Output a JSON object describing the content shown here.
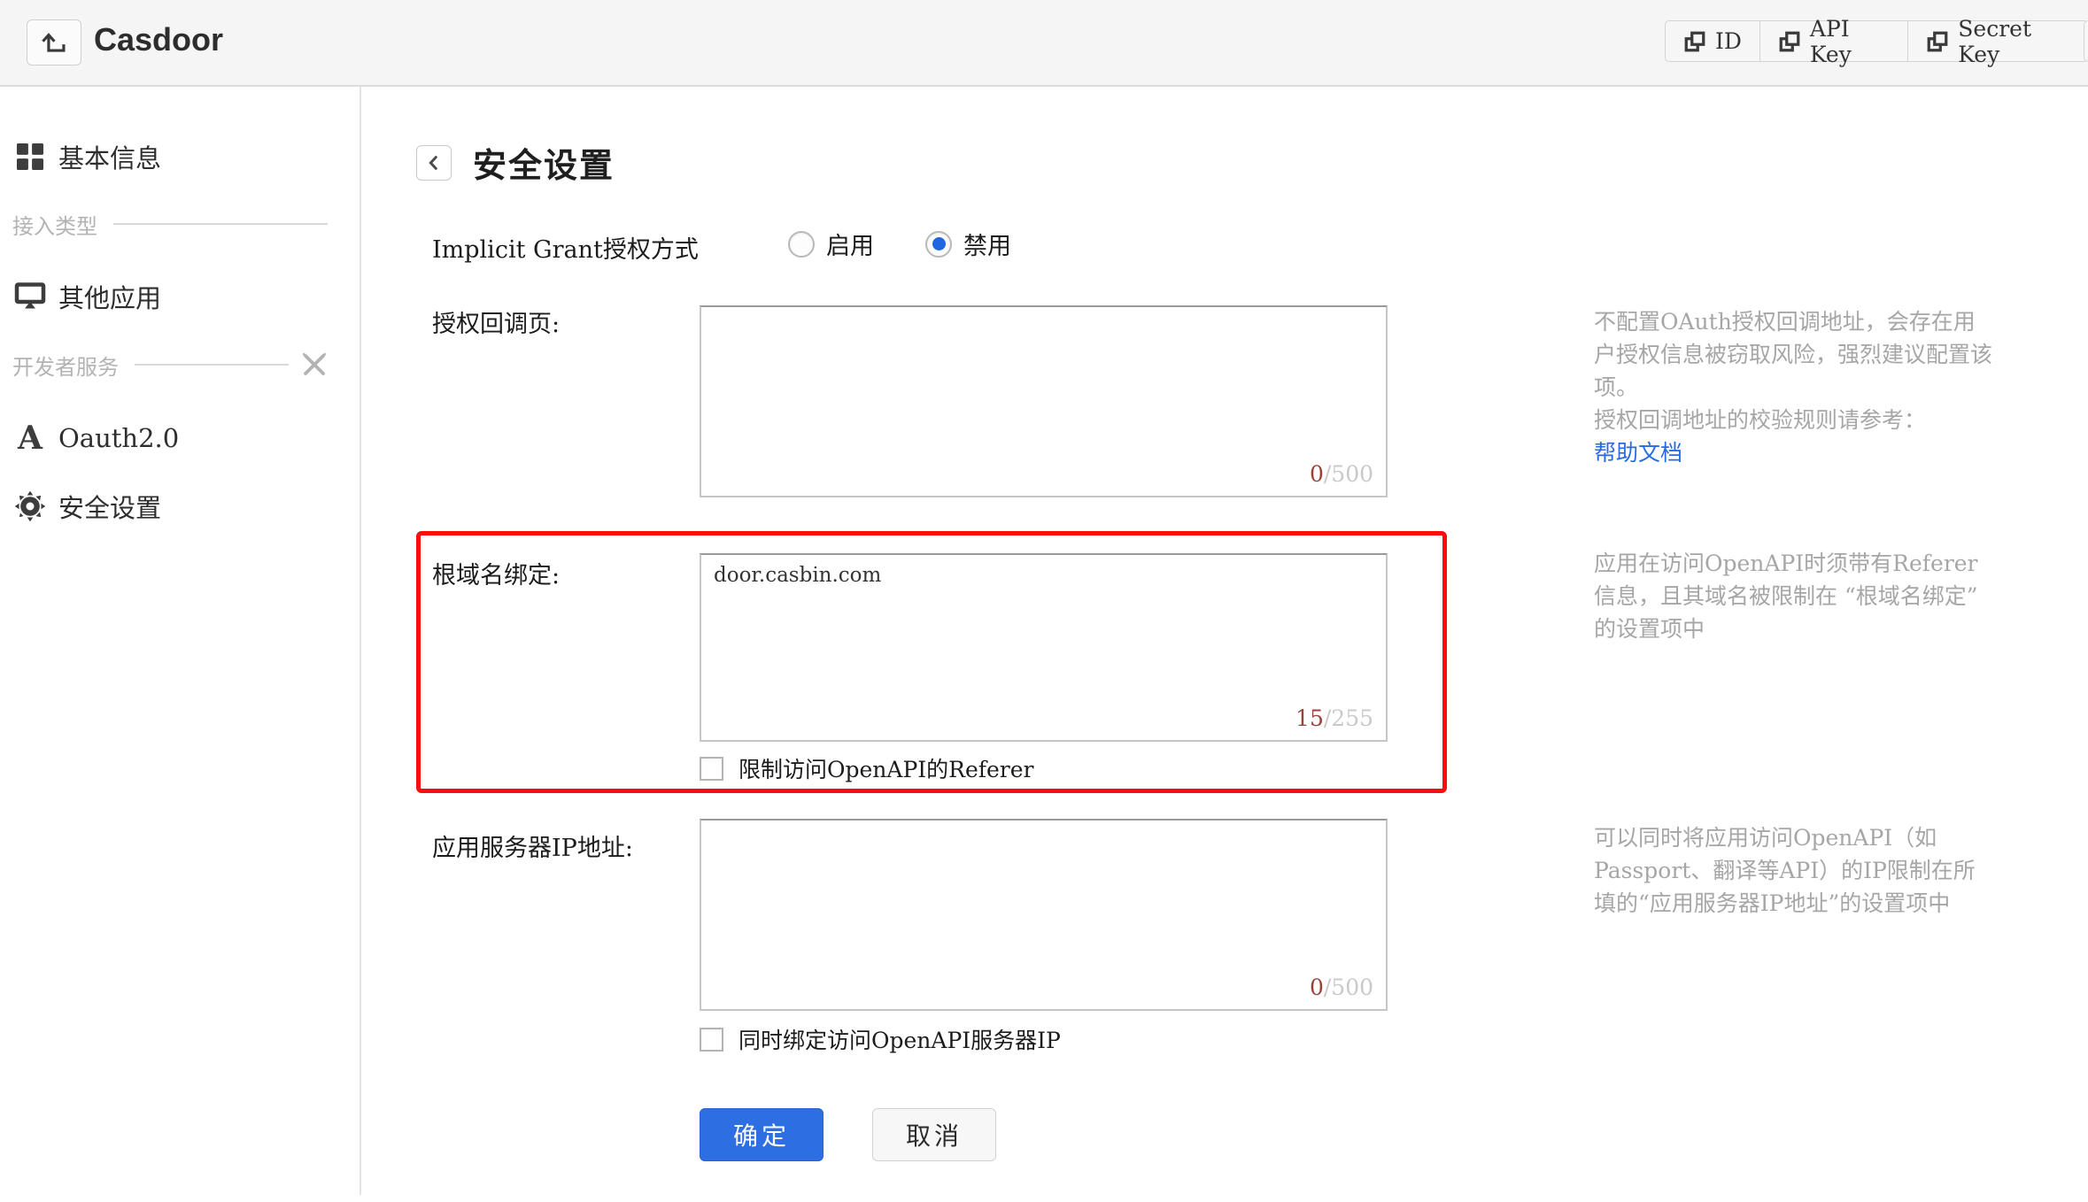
{
  "header": {
    "app_title": "Casdoor",
    "copy_buttons": [
      {
        "label": "ID"
      },
      {
        "label": "API Key"
      },
      {
        "label": "Secret Key"
      }
    ]
  },
  "sidebar": {
    "items": [
      {
        "label": "基本信息",
        "icon": "grid-icon"
      },
      {
        "label": "其他应用",
        "icon": "monitor-icon"
      },
      {
        "label": "Oauth2.0",
        "icon": "oauth-a-icon"
      },
      {
        "label": "安全设置",
        "icon": "gear-icon"
      }
    ],
    "dividers": [
      {
        "label": "接入类型"
      },
      {
        "label": "开发者服务",
        "icon": "tools-icon"
      }
    ]
  },
  "main": {
    "page_title": "安全设置",
    "implicit": {
      "label": "Implicit Grant授权方式",
      "options": [
        {
          "label": "启用",
          "selected": false
        },
        {
          "label": "禁用",
          "selected": true
        }
      ]
    },
    "fields": {
      "callback": {
        "label": "授权回调页:",
        "value": "",
        "counter_current": "0",
        "counter_max": "/500",
        "help1": "不配置OAuth授权回调地址，会存在用户授权信息被窃取风险，强烈建议配置该项。",
        "help2": "授权回调地址的校验规则请参考：",
        "help_link": "帮助文档"
      },
      "root_domain": {
        "label": "根域名绑定:",
        "value": "door.casbin.com",
        "counter_current": "15",
        "counter_max": "/255",
        "checkbox_label": "限制访问OpenAPI的Referer",
        "checkbox_checked": false,
        "help": "应用在访问OpenAPI时须带有Referer信息，且其域名被限制在 “根域名绑定” 的设置项中",
        "highlighted": true
      },
      "server_ip": {
        "label": "应用服务器IP地址:",
        "value": "",
        "counter_current": "0",
        "counter_max": "/500",
        "checkbox_label": "同时绑定访问OpenAPI服务器IP",
        "checkbox_checked": false,
        "help": "可以同时将应用访问OpenAPI（如Passport、翻译等API）的IP限制在所填的“应用服务器IP地址”的设置项中"
      }
    },
    "actions": {
      "ok": "确定",
      "cancel": "取消"
    }
  },
  "colors": {
    "primary_blue": "#2d6fe2",
    "radio_selected_blue": "#2166e0",
    "link_blue": "#2a6ae0",
    "highlight_red": "#fb0d0d",
    "counter_red": "#9c4038",
    "counter_gray": "#c9c9c9",
    "header_bg": "#f5f5f5"
  }
}
